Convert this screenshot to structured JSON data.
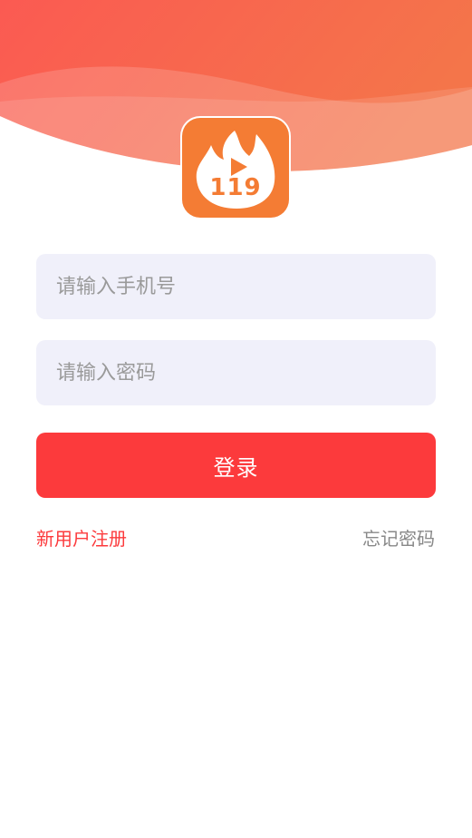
{
  "header": {
    "gradient_start": "#fb5a52",
    "gradient_end": "#f4754a"
  },
  "logo": {
    "number": "119",
    "icon": "flame-play-icon",
    "background": "#f47c34"
  },
  "form": {
    "phone_placeholder": "请输入手机号",
    "password_placeholder": "请输入密码",
    "login_label": "登录",
    "field_background": "#f0f0fa"
  },
  "links": {
    "register_label": "新用户注册",
    "forgot_label": "忘记密码"
  },
  "colors": {
    "primary": "#fc3a3c",
    "secondary_text": "#888888"
  }
}
